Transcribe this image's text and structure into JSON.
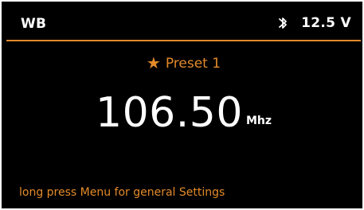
{
  "header": {
    "title": "WB",
    "voltage": "12.5 V",
    "icons": {
      "bluetooth": "bluetooth-icon"
    }
  },
  "main": {
    "preset_label": "Preset 1",
    "frequency_value": "106.50",
    "frequency_unit": "Mhz"
  },
  "footer": {
    "hint": "long press Menu for general Settings"
  },
  "colors": {
    "background": "#000000",
    "accent": "#e38a2a",
    "text": "#ffffff"
  }
}
